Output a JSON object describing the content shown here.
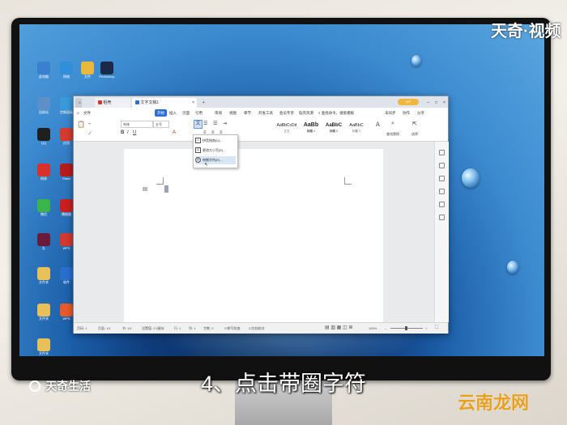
{
  "watermark_top_right": "天奇·视频",
  "watermark_bottom_left": "天奇生活",
  "watermark_bottom_right": "云南龙网",
  "caption": "4、点击带圈字符",
  "desktop_icons": [
    {
      "label": "此电脑",
      "color": "#3b7fd0"
    },
    {
      "label": "网络",
      "color": "#2f8fd8"
    },
    {
      "label": "文件",
      "color": "#e9b93c"
    },
    {
      "label": "Photoshop",
      "color": "#1c2a4a"
    },
    {
      "label": "回收站",
      "color": "#5d8fc8"
    },
    {
      "label": "控制面板",
      "color": "#3a9ad9"
    },
    {
      "label": "QQ",
      "color": "#1f1f1f"
    },
    {
      "label": "应用",
      "color": "#d33b2f"
    },
    {
      "label": "网易",
      "color": "#d8302a"
    },
    {
      "label": "Flash",
      "color": "#b51d1d"
    },
    {
      "label": "微信",
      "color": "#39b54a"
    },
    {
      "label": "播放器",
      "color": "#c82020"
    },
    {
      "label": "丸",
      "color": "#6a1a3a"
    },
    {
      "label": "WPS",
      "color": "#d33a2f"
    },
    {
      "label": "文件夹",
      "color": "#e8c05a"
    },
    {
      "label": "软件",
      "color": "#2a6fd0"
    },
    {
      "label": "文件夹",
      "color": "#e8c05a"
    },
    {
      "label": "WPS",
      "color": "#e85a2a"
    },
    {
      "label": "文件夹",
      "color": "#e8c05a"
    }
  ],
  "wps": {
    "tabs": [
      {
        "label": "稻壳"
      },
      {
        "label": "文字文稿1"
      }
    ],
    "menu": [
      "文件",
      "开始",
      "插入",
      "页面",
      "引用",
      "审阅",
      "视图",
      "章节",
      "开发工具",
      "会员专享",
      "稻壳资源",
      "查找命令、搜索模板"
    ],
    "menu_right": [
      "未同步",
      "协作",
      "分享"
    ],
    "font_name": "宋体",
    "font_size": "五号",
    "styles": [
      {
        "sample": "AaBbCcDd",
        "name": "正文"
      },
      {
        "sample": "AaBb",
        "name": "标题 1"
      },
      {
        "sample": "AaBbC",
        "name": "标题 2"
      },
      {
        "sample": "AaBbC",
        "name": "标题 3"
      }
    ],
    "ribbon_right": [
      "查找替换",
      "选择"
    ],
    "dropdown": [
      {
        "icon": "A",
        "label": "拼音指南(U)..."
      },
      {
        "icon": "字",
        "label": "更改大小写(E)..."
      },
      {
        "icon": "字",
        "label": "带圈字符(E)..."
      }
    ],
    "status": {
      "page": "页码: 1",
      "pages": "页面: 1/1",
      "section": "节: 1/1",
      "settings": "设置值: 2.5厘米",
      "row": "行: 1",
      "col": "列: 1",
      "words": "字数: 0",
      "spell": "拼写检查",
      "proofread": "文档校对",
      "zoom": "100%"
    }
  }
}
